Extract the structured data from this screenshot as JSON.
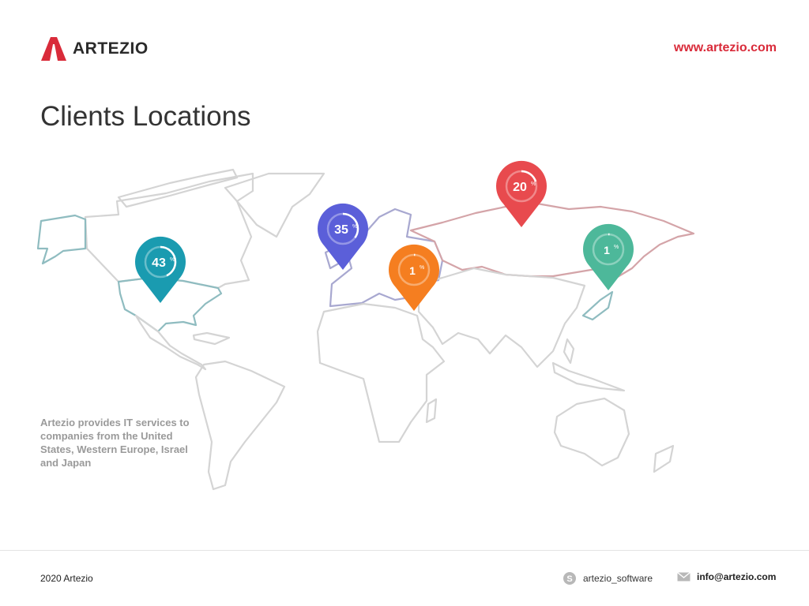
{
  "header": {
    "logo_text": "ARTEZIO",
    "website": "www.artezio.com",
    "brand_color": "#d92b3a"
  },
  "title": "Clients Locations",
  "description": "Artezio provides IT services to companies from the United States, Western Europe, Israel and Japan",
  "map": {
    "pins": [
      {
        "region": "North America",
        "value": "43",
        "unit": "%",
        "color": "#1a9bb0",
        "share": 0.43
      },
      {
        "region": "Western Europe",
        "value": "35",
        "unit": "%",
        "color": "#5b5fd9",
        "share": 0.35
      },
      {
        "region": "Israel",
        "value": "1",
        "unit": "%",
        "color": "#f57e20",
        "share": 0.01
      },
      {
        "region": "Russia",
        "value": "20",
        "unit": "%",
        "color": "#e84a4e",
        "share": 0.2
      },
      {
        "region": "Japan",
        "value": "1",
        "unit": "%",
        "color": "#4db89a",
        "share": 0.01
      }
    ],
    "region_colors": {
      "land": "#d4d4d4",
      "north_america": "#8fbcc0",
      "europe": "#a8a8d0",
      "russia": "#d4a4a8"
    }
  },
  "footer": {
    "year": "2020 Artezio",
    "skype": "artezio_software",
    "skype_icon": "skype-icon",
    "email": "info@artezio.com",
    "email_icon": "mail-icon"
  }
}
